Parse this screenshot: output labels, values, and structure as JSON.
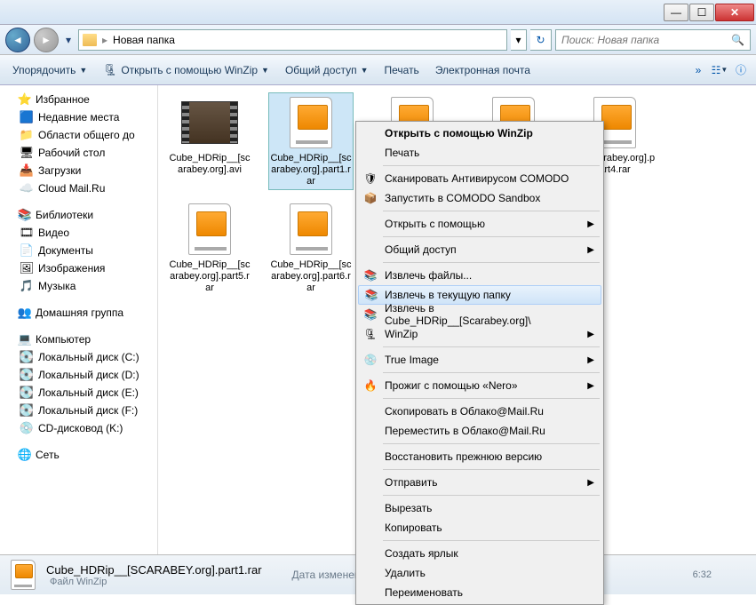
{
  "titlebar": {},
  "addr": {
    "path": "Новая папка",
    "search_placeholder": "Поиск: Новая папка"
  },
  "toolbar": {
    "organize": "Упорядочить",
    "open_winzip": "Открыть с помощью WinZip",
    "share": "Общий доступ",
    "print": "Печать",
    "email": "Электронная почта"
  },
  "sidebar": {
    "favorites": {
      "hdr": "Избранное",
      "items": [
        "Недавние места",
        "Области общего до",
        "Рабочий стол",
        "Загрузки",
        "Cloud Mail.Ru"
      ]
    },
    "libraries": {
      "hdr": "Библиотеки",
      "items": [
        "Видео",
        "Документы",
        "Изображения",
        "Музыка"
      ]
    },
    "homegroup": {
      "hdr": "Домашняя группа"
    },
    "computer": {
      "hdr": "Компьютер",
      "items": [
        "Локальный диск (C:)",
        "Локальный диск (D:)",
        "Локальный диск (E:)",
        "Локальный диск (F:)",
        "CD-дисковод (K:)"
      ]
    },
    "network": {
      "hdr": "Сеть"
    }
  },
  "files": [
    {
      "label": "Cube_HDRip__[scarabey.org].avi",
      "type": "avi"
    },
    {
      "label": "Cube_HDRip__[scarabey.org].part1.rar",
      "type": "rar",
      "selected": true
    },
    {
      "label": "",
      "type": "rar"
    },
    {
      "label": "",
      "type": "rar"
    },
    {
      "label": "__[scarabey.org].part4.rar",
      "type": "rar"
    },
    {
      "label": "Cube_HDRip__[scarabey.org].part5.rar",
      "type": "rar"
    },
    {
      "label": "Cube_HDRip__[scarabey.org].part6.rar",
      "type": "rar"
    }
  ],
  "ctx": {
    "items": [
      {
        "label": "Открыть с помощью WinZip",
        "bold": true
      },
      {
        "label": "Печать"
      },
      {
        "sep": true
      },
      {
        "label": "Сканировать Антивирусом COMODO",
        "icon": "🛡"
      },
      {
        "label": "Запустить в COMODO Sandbox",
        "icon": "📦"
      },
      {
        "sep": true
      },
      {
        "label": "Открыть с помощью",
        "arrow": true
      },
      {
        "sep": true
      },
      {
        "label": "Общий доступ",
        "arrow": true
      },
      {
        "sep": true
      },
      {
        "label": "Извлечь файлы...",
        "icon": "📚"
      },
      {
        "label": "Извлечь в текущую папку",
        "icon": "📚",
        "hover": true
      },
      {
        "label": "Извлечь в Cube_HDRip__[Scarabey.org]\\",
        "icon": "📚"
      },
      {
        "label": "WinZip",
        "icon": "🗜",
        "arrow": true
      },
      {
        "sep": true
      },
      {
        "label": "True Image",
        "icon": "💿",
        "arrow": true
      },
      {
        "sep": true
      },
      {
        "label": "Прожиг с помощью «Nero»",
        "icon": "🔥",
        "arrow": true
      },
      {
        "sep": true
      },
      {
        "label": "Скопировать в Облако@Mail.Ru"
      },
      {
        "label": "Переместить в Облако@Mail.Ru"
      },
      {
        "sep": true
      },
      {
        "label": "Восстановить прежнюю версию"
      },
      {
        "sep": true
      },
      {
        "label": "Отправить",
        "arrow": true
      },
      {
        "sep": true
      },
      {
        "label": "Вырезать"
      },
      {
        "label": "Копировать"
      },
      {
        "sep": true
      },
      {
        "label": "Создать ярлык"
      },
      {
        "label": "Удалить"
      },
      {
        "label": "Переименовать"
      }
    ]
  },
  "status": {
    "name": "Cube_HDRip__[SCARABEY.org].part1.rar",
    "type": "Файл WinZip",
    "meta1_label": "Дата изменени",
    "meta2": "6:32"
  }
}
